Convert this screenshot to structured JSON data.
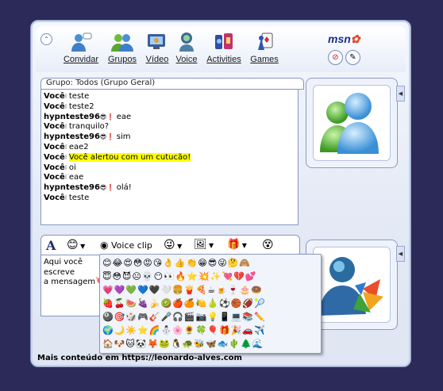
{
  "toolbar": {
    "items": [
      {
        "label": "Convidar",
        "icon": "invite-icon"
      },
      {
        "label": "Grupos",
        "icon": "groups-icon"
      },
      {
        "label": "Vídeo",
        "icon": "video-icon"
      },
      {
        "label": "Voice",
        "icon": "voice-icon"
      },
      {
        "label": "Activities",
        "icon": "activities-icon"
      },
      {
        "label": "Games",
        "icon": "games-icon"
      }
    ],
    "brand": "msn"
  },
  "conversation": {
    "header": "Grupo: Todos (Grupo Geral)",
    "messages": [
      {
        "sender": "Você",
        "text": "teste"
      },
      {
        "sender": "Você",
        "text": "teste2"
      },
      {
        "sender": "hypnteste96",
        "text": "eae"
      },
      {
        "sender": "Você",
        "text": "tranquilo?"
      },
      {
        "sender": "hypnteste96",
        "text": "sim"
      },
      {
        "sender": "Você",
        "text": "eae2"
      },
      {
        "sender": "Você",
        "text": "Você alertou com um cutucão!"
      },
      {
        "sender": "Você",
        "text": "oi"
      },
      {
        "sender": "Você",
        "text": "eae"
      },
      {
        "sender": "hypnteste96",
        "text": "olá!"
      },
      {
        "sender": "Você",
        "text": "teste"
      }
    ]
  },
  "input_toolbar": {
    "font_glyph": "A",
    "voice_clip": "Voice clip"
  },
  "input": {
    "text_line1": "Aqui você",
    "text_line2": "escreve",
    "text_line3": "a mensagem"
  },
  "emoji_rows": [
    "😊😂😍😳😡😘👌👍👏😁😎😜🤔🙈",
    "😇😳😈😐💀😶👀🔥⭐💥✨💘💔💕",
    "💗💜💚💙🖤🤍🍔🍟🍕☕🍺🍷🎂🍩",
    "🍓🍒🍉🍇🍌🥝🍎🍊🍋🍐⚽🏀🏈🎾",
    "🎱🎯🎲🎮🎸🎤🎧🎬📷💡📱💻📚✏️",
    "🌍🌙☀️⭐🌈⛄🌸🌻🍀🎈🎁🎉🚗✈️",
    "🏠🐶🐱🐼🦊🐸🐧🐢🐝🦋🐟🌵🌲🌊"
  ],
  "footer": {
    "prefix": "Mais conteúdo em",
    "link": "https://leonardo-alves.com"
  },
  "colors": {
    "background": "#2c2a58",
    "highlight": "#ffff00"
  }
}
